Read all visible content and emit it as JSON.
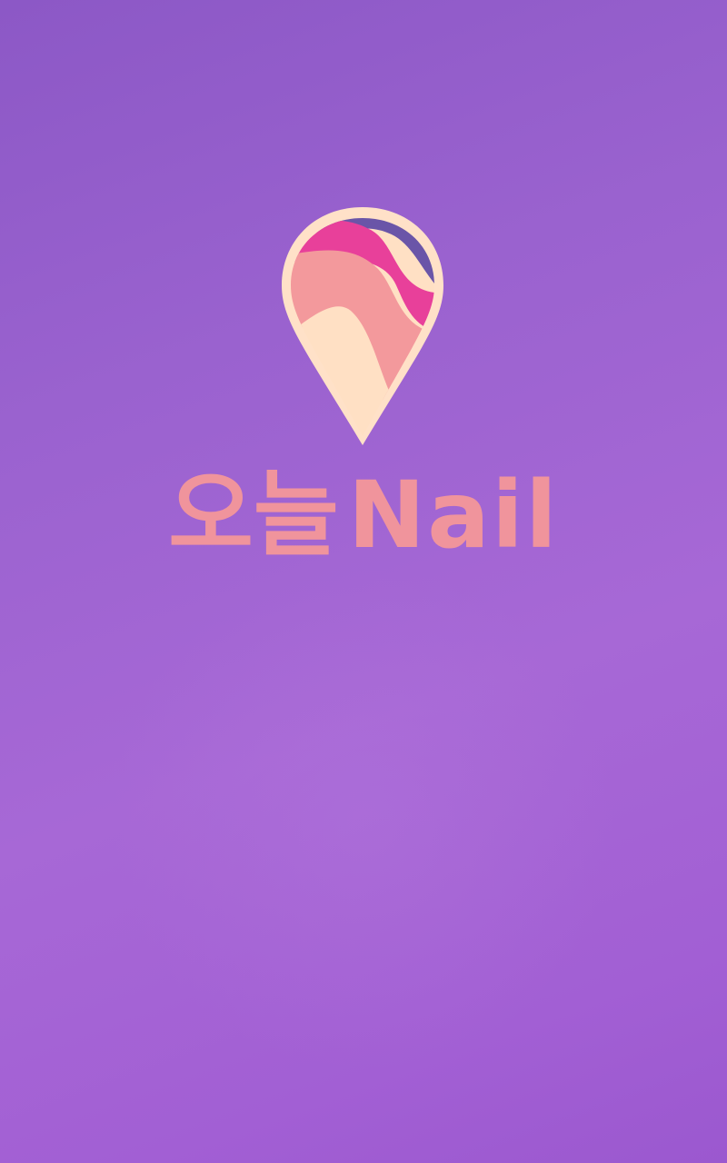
{
  "splash": {
    "brand_korean": "오늘",
    "brand_english": "Nail",
    "logo_icon": "map-pin-nail-icon"
  },
  "colors": {
    "background_start": "#8c58c6",
    "background_end": "#a768d6",
    "brand_text": "#f0949c",
    "pin_outline": "#ffe1c8",
    "pin_cream": "#ffe0c4",
    "pin_pink": "#f3999c",
    "pin_magenta": "#e8409a",
    "pin_violet": "#6a55a8"
  }
}
